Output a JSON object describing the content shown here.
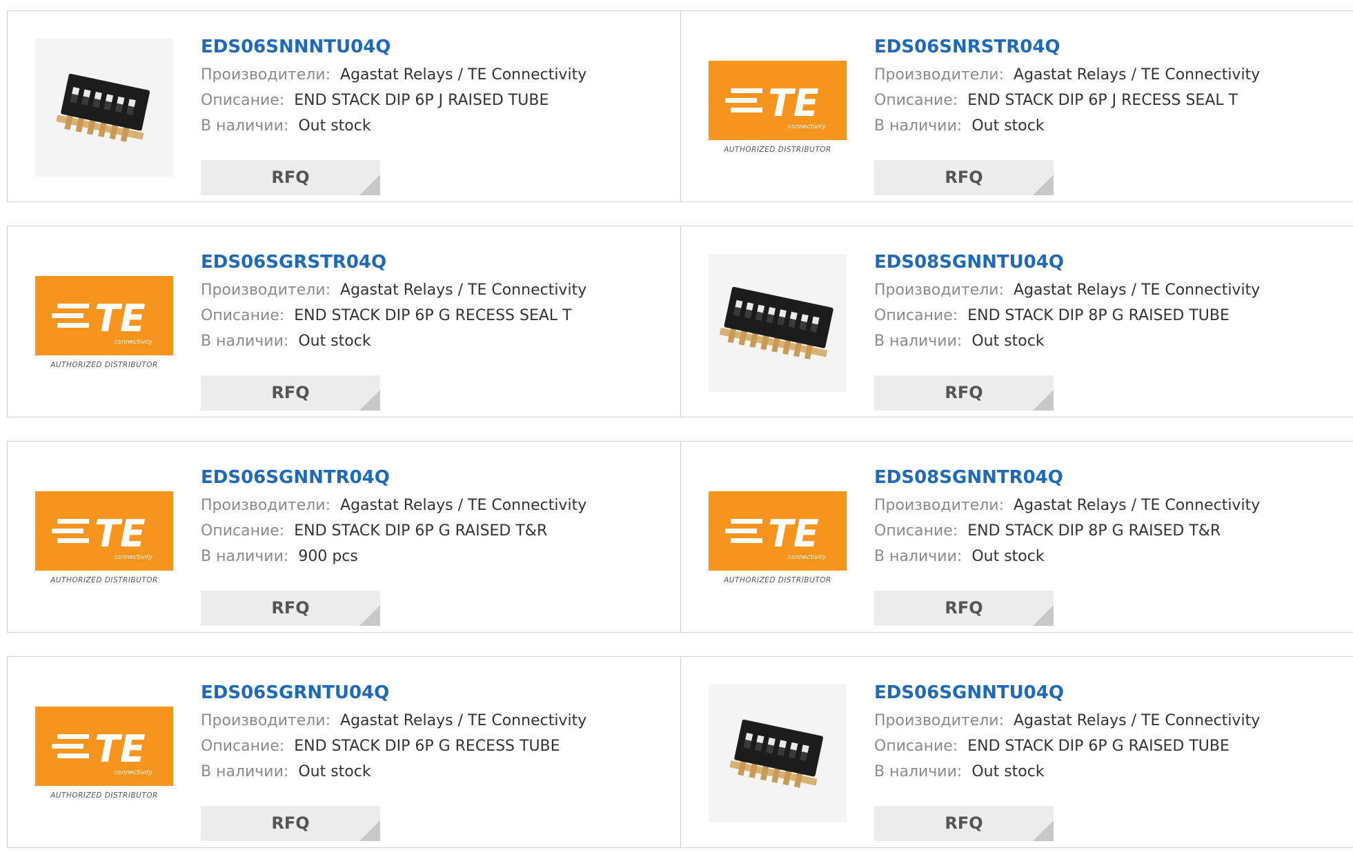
{
  "labels": {
    "manufacturer": "Производители:",
    "description": "Описание:",
    "stock": "В наличии:",
    "rfq": "RFQ"
  },
  "logo": {
    "text": "TE",
    "sub": "connectivity",
    "distributor": "AUTHORIZED DISTRIBUTOR",
    "color": "#f7941d"
  },
  "products": [
    {
      "pn": "EDS06SNNNTU04Q",
      "manufacturer": "Agastat Relays / TE Connectivity",
      "description": "END STACK DIP 6P J RAISED TUBE",
      "stock": "Out stock",
      "image": "dip-switch-6-photo"
    },
    {
      "pn": "EDS06SNRSTR04Q",
      "manufacturer": "Agastat Relays / TE Connectivity",
      "description": "END STACK DIP 6P J RECESS SEAL T",
      "stock": "Out stock",
      "image": "te-logo"
    },
    {
      "pn": "EDS06SGRSTR04Q",
      "manufacturer": "Agastat Relays / TE Connectivity",
      "description": "END STACK DIP 6P G RECESS SEAL T",
      "stock": "Out stock",
      "image": "te-logo"
    },
    {
      "pn": "EDS08SGNNTU04Q",
      "manufacturer": "Agastat Relays / TE Connectivity",
      "description": "END STACK DIP 8P G RAISED TUBE",
      "stock": "Out stock",
      "image": "dip-switch-8-photo"
    },
    {
      "pn": "EDS06SGNNTR04Q",
      "manufacturer": "Agastat Relays / TE Connectivity",
      "description": "END STACK DIP 6P G RAISED T&R",
      "stock": "900 pcs",
      "image": "te-logo"
    },
    {
      "pn": "EDS08SGNNTR04Q",
      "manufacturer": "Agastat Relays / TE Connectivity",
      "description": "END STACK DIP 8P G RAISED T&R",
      "stock": "Out stock",
      "image": "te-logo"
    },
    {
      "pn": "EDS06SGRNTU04Q",
      "manufacturer": "Agastat Relays / TE Connectivity",
      "description": "END STACK DIP 6P G RECESS TUBE",
      "stock": "Out stock",
      "image": "te-logo"
    },
    {
      "pn": "EDS06SGNNTU04Q",
      "manufacturer": "Agastat Relays / TE Connectivity",
      "description": "END STACK DIP 6P G RAISED TUBE",
      "stock": "Out stock",
      "image": "dip-switch-6-photo"
    }
  ]
}
